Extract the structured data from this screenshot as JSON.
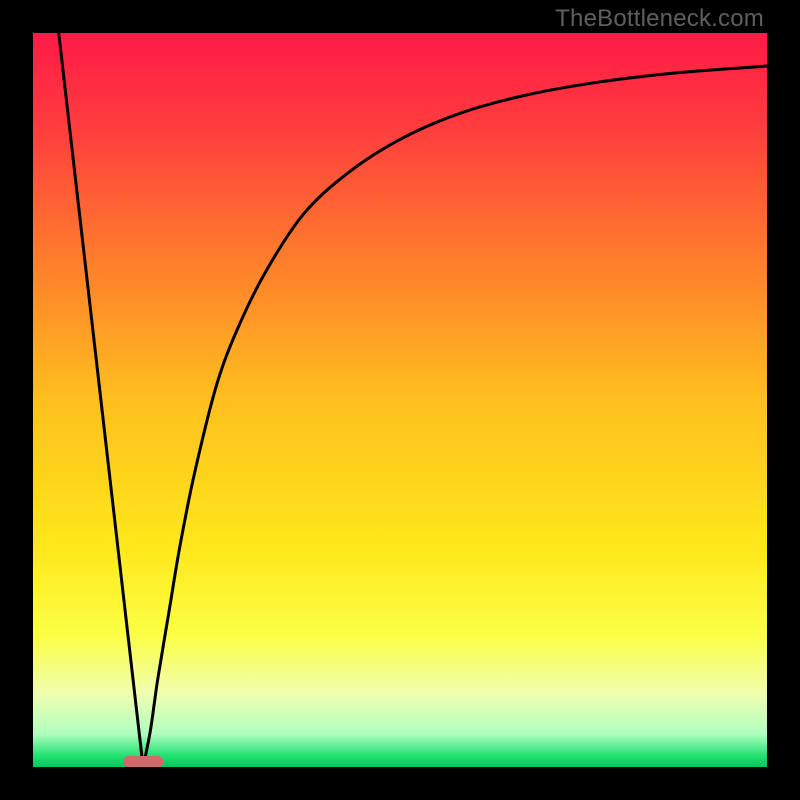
{
  "watermark": "TheBottleneck.com",
  "chart_data": {
    "type": "line",
    "title": "",
    "xlabel": "",
    "ylabel": "",
    "xlim": [
      0,
      100
    ],
    "ylim": [
      0,
      100
    ],
    "optimum_x": 15,
    "gradient_stops": [
      {
        "offset": 0.0,
        "color": "#ff1a47"
      },
      {
        "offset": 0.12,
        "color": "#ff3a3f"
      },
      {
        "offset": 0.3,
        "color": "#ff7a2c"
      },
      {
        "offset": 0.5,
        "color": "#ffbf1f"
      },
      {
        "offset": 0.7,
        "color": "#ffe81a"
      },
      {
        "offset": 0.82,
        "color": "#fbff45"
      },
      {
        "offset": 0.9,
        "color": "#f0ffb0"
      },
      {
        "offset": 0.955,
        "color": "#b0ffc0"
      },
      {
        "offset": 0.985,
        "color": "#20e070"
      },
      {
        "offset": 1.0,
        "color": "#00c85a"
      }
    ],
    "marker": {
      "x": 15,
      "y": 0.7,
      "width": 5.5,
      "height": 1.6,
      "color": "#d06a6a"
    },
    "left_line": {
      "x1": 3.5,
      "y1": 100,
      "x2": 15,
      "y2": 0
    },
    "right_curve": [
      {
        "x": 15,
        "y": 0
      },
      {
        "x": 16,
        "y": 5
      },
      {
        "x": 17,
        "y": 12
      },
      {
        "x": 18.5,
        "y": 21
      },
      {
        "x": 20,
        "y": 30
      },
      {
        "x": 22,
        "y": 40
      },
      {
        "x": 25,
        "y": 52
      },
      {
        "x": 28,
        "y": 60
      },
      {
        "x": 32,
        "y": 68
      },
      {
        "x": 37,
        "y": 75.5
      },
      {
        "x": 43,
        "y": 81
      },
      {
        "x": 50,
        "y": 85.5
      },
      {
        "x": 58,
        "y": 89
      },
      {
        "x": 67,
        "y": 91.5
      },
      {
        "x": 77,
        "y": 93.3
      },
      {
        "x": 88,
        "y": 94.6
      },
      {
        "x": 100,
        "y": 95.5
      }
    ]
  }
}
